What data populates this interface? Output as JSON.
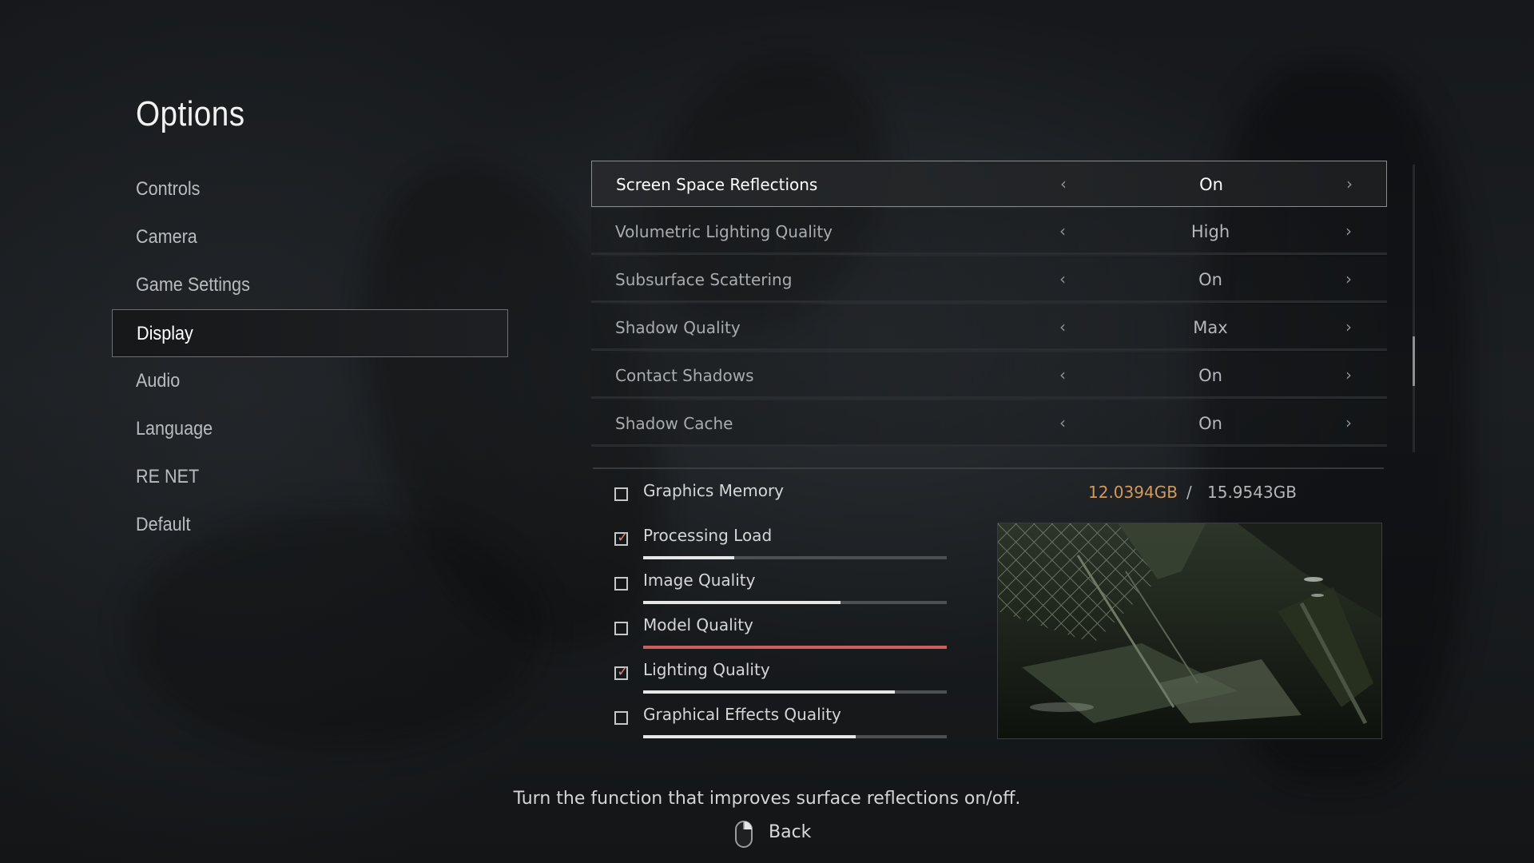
{
  "title": "Options",
  "menu": {
    "items": [
      {
        "label": "Controls",
        "active": false
      },
      {
        "label": "Camera",
        "active": false
      },
      {
        "label": "Game Settings",
        "active": false
      },
      {
        "label": "Display",
        "active": true
      },
      {
        "label": "Audio",
        "active": false
      },
      {
        "label": "Language",
        "active": false
      },
      {
        "label": "RE NET",
        "active": false
      },
      {
        "label": "Default",
        "active": false
      }
    ]
  },
  "settings": [
    {
      "label": "Screen Space Reflections",
      "value": "On",
      "selected": true
    },
    {
      "label": "Volumetric Lighting Quality",
      "value": "High",
      "selected": false
    },
    {
      "label": "Subsurface Scattering",
      "value": "On",
      "selected": false
    },
    {
      "label": "Shadow Quality",
      "value": "Max",
      "selected": false
    },
    {
      "label": "Contact Shadows",
      "value": "On",
      "selected": false
    },
    {
      "label": "Shadow Cache",
      "value": "On",
      "selected": false
    }
  ],
  "arrows": {
    "left": "‹",
    "right": "›"
  },
  "scroll": {
    "position_fraction": 0.72
  },
  "graphics_memory": {
    "used": "12.0394GB",
    "separator": "/",
    "total": "15.9543GB",
    "used_color": "#d39a5e"
  },
  "performance": [
    {
      "label": "Graphics Memory",
      "checked": false,
      "bar": null
    },
    {
      "label": "Processing Load",
      "checked": true,
      "bar": 0.3,
      "warn": false
    },
    {
      "label": "Image Quality",
      "checked": false,
      "bar": 0.65,
      "warn": false
    },
    {
      "label": "Model Quality",
      "checked": false,
      "bar": 1.0,
      "warn": true
    },
    {
      "label": "Lighting Quality",
      "checked": true,
      "bar": 0.83,
      "warn": false
    },
    {
      "label": "Graphical Effects Quality",
      "checked": false,
      "bar": 0.7,
      "warn": false
    }
  ],
  "check_glyph": "✓",
  "preview": {
    "icon": "scene-preview-image"
  },
  "description": "Turn the function that improves surface reflections on/off.",
  "back": {
    "label": "Back",
    "icon": "mouse-right-click-icon"
  },
  "colors": {
    "accent_check": "#d88072",
    "warn_bar": "#c9605a",
    "bar_fill": "#e6e6e6"
  }
}
